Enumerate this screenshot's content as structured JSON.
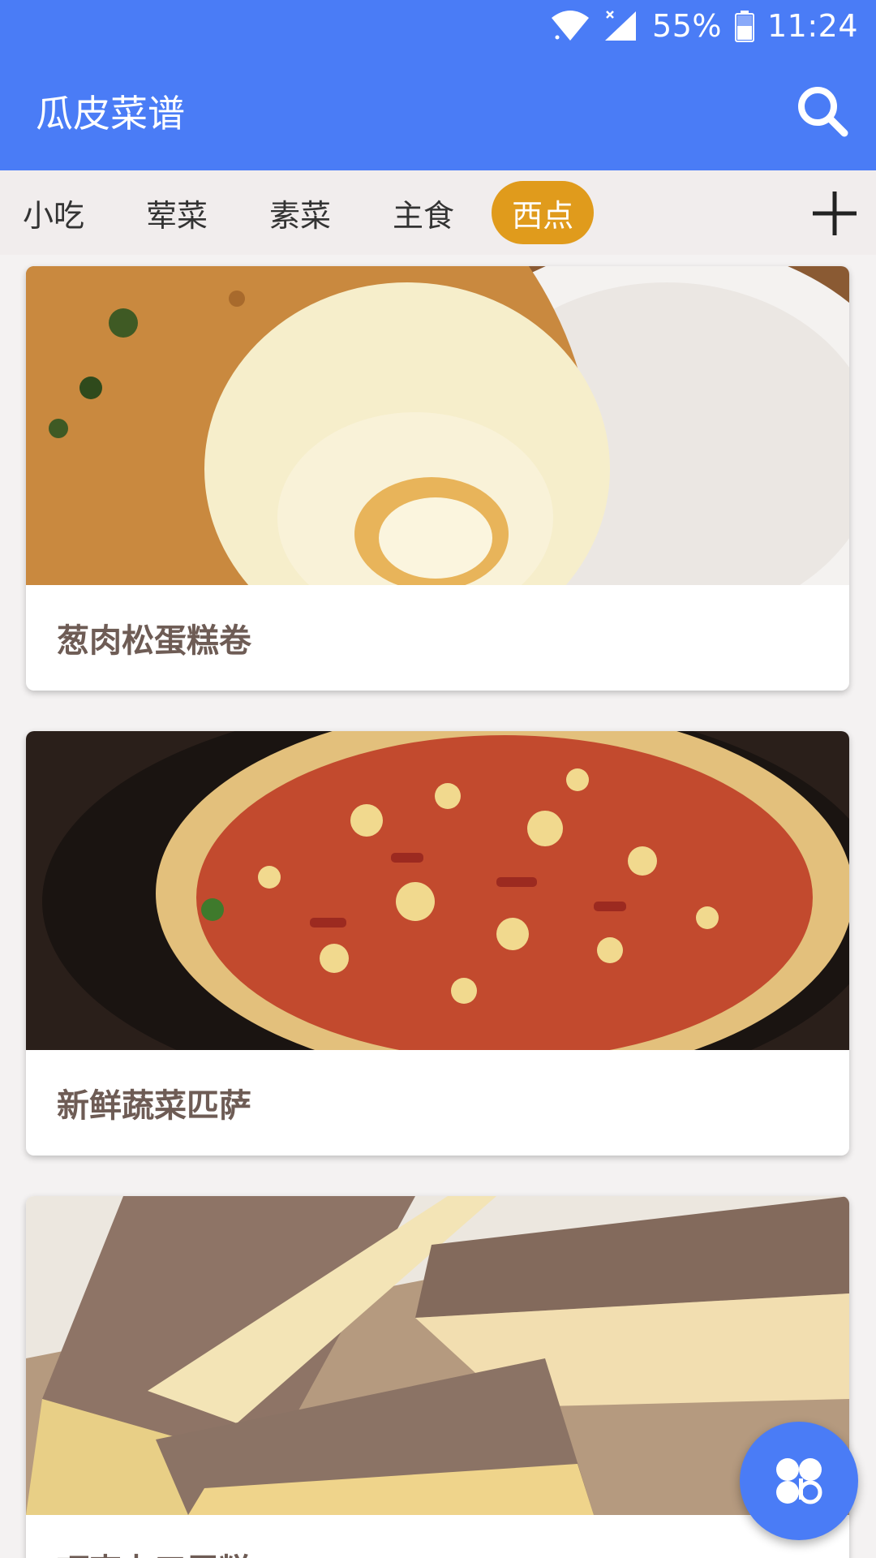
{
  "status_bar": {
    "battery": "55%",
    "time": "11:24",
    "icons": [
      "wifi-icon",
      "signal-icon",
      "battery-icon"
    ]
  },
  "app_bar": {
    "title": "瓜皮菜谱",
    "search_icon": "search-icon"
  },
  "tabs": {
    "items": [
      {
        "label": "小吃",
        "active": false
      },
      {
        "label": "荤菜",
        "active": false
      },
      {
        "label": "素菜",
        "active": false
      },
      {
        "label": "主食",
        "active": false
      },
      {
        "label": "西点",
        "active": true
      }
    ],
    "add_icon": "plus-icon"
  },
  "recipes": [
    {
      "title": "葱肉松蛋糕卷",
      "image": "pork-floss-cake-roll"
    },
    {
      "title": "新鲜蔬菜匹萨",
      "image": "vegetable-pizza"
    },
    {
      "title": "巧克力三层糕",
      "image": "layered-cake"
    }
  ],
  "fab": {
    "icon": "clover-icon"
  },
  "colors": {
    "primary": "#4a7cf6",
    "active_tab": "#e09b1c",
    "caption_text": "#6e5c55",
    "tab_bar_bg": "#f1eded"
  }
}
